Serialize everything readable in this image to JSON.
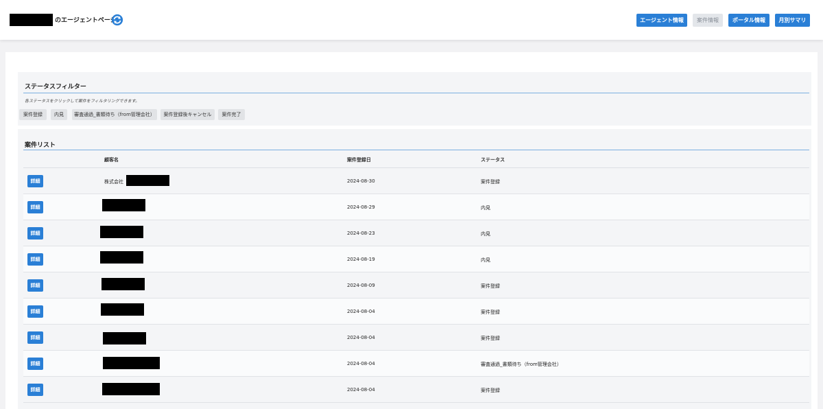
{
  "header": {
    "page_title": "のエージェントページ",
    "nav": [
      {
        "label": "エージェント情報",
        "active": true
      },
      {
        "label": "案件情報",
        "active": false
      },
      {
        "label": "ポータル情報",
        "active": true
      },
      {
        "label": "月別サマリ",
        "active": true
      }
    ]
  },
  "filter": {
    "title": "ステータスフィルター",
    "hint": "各ステータスをクリックして案件をフィルタリングできます。",
    "chips": [
      "案件登録",
      "内見",
      "審査通過_書類待ち（from管理会社）",
      "案件登録後キャンセル",
      "案件完了"
    ]
  },
  "list": {
    "title": "案件リスト",
    "columns": [
      "顧客名",
      "案件登録日",
      "ステータス"
    ],
    "detail_label": "詳細",
    "rows": [
      {
        "customer": "株式会社",
        "date": "2024-08-30",
        "status": "案件登録"
      },
      {
        "customer": "",
        "date": "2024-08-29",
        "status": "内見"
      },
      {
        "customer": "",
        "date": "2024-08-23",
        "status": "内見"
      },
      {
        "customer": "",
        "date": "2024-08-19",
        "status": "内見"
      },
      {
        "customer": "",
        "date": "2024-08-09",
        "status": "案件登録"
      },
      {
        "customer": "",
        "date": "2024-08-04",
        "status": "案件登録"
      },
      {
        "customer": "",
        "date": "2024-08-04",
        "status": "案件登録"
      },
      {
        "customer": "",
        "date": "2024-08-04",
        "status": "審査通過_書類待ち（from管理会社）"
      },
      {
        "customer": "",
        "date": "2024-08-04",
        "status": "案件登録"
      }
    ]
  },
  "colors": {
    "accent": "#2a7fd6",
    "disabled_bg": "#e3e6ea",
    "divider": "#7aaee0"
  }
}
